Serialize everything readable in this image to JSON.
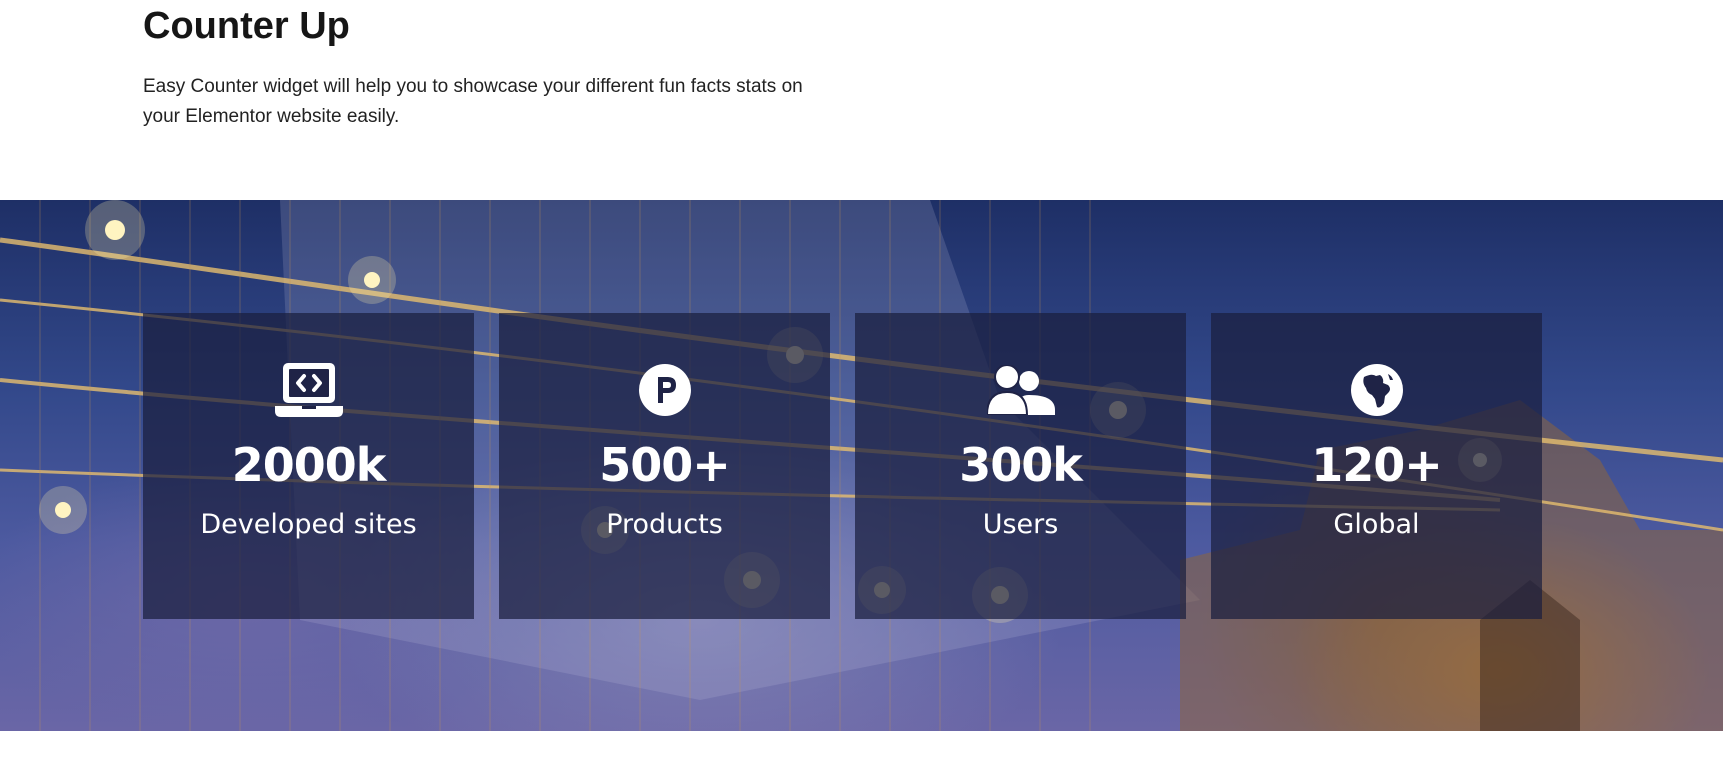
{
  "header": {
    "title": "Counter Up",
    "description": "Easy Counter widget will help you to showcase your different fun facts stats on your Elementor website easily."
  },
  "counters": [
    {
      "icon": "laptop-code-icon",
      "value": "2000k",
      "label": "Developed sites"
    },
    {
      "icon": "product-hunt-icon",
      "value": "500+",
      "label": "Products"
    },
    {
      "icon": "users-icon",
      "value": "300k",
      "label": "Users"
    },
    {
      "icon": "globe-africa-icon",
      "value": "120+",
      "label": "Global"
    }
  ],
  "colors": {
    "card_bg": "#1a1e3e",
    "text_light": "#ffffff",
    "title": "#161616"
  }
}
